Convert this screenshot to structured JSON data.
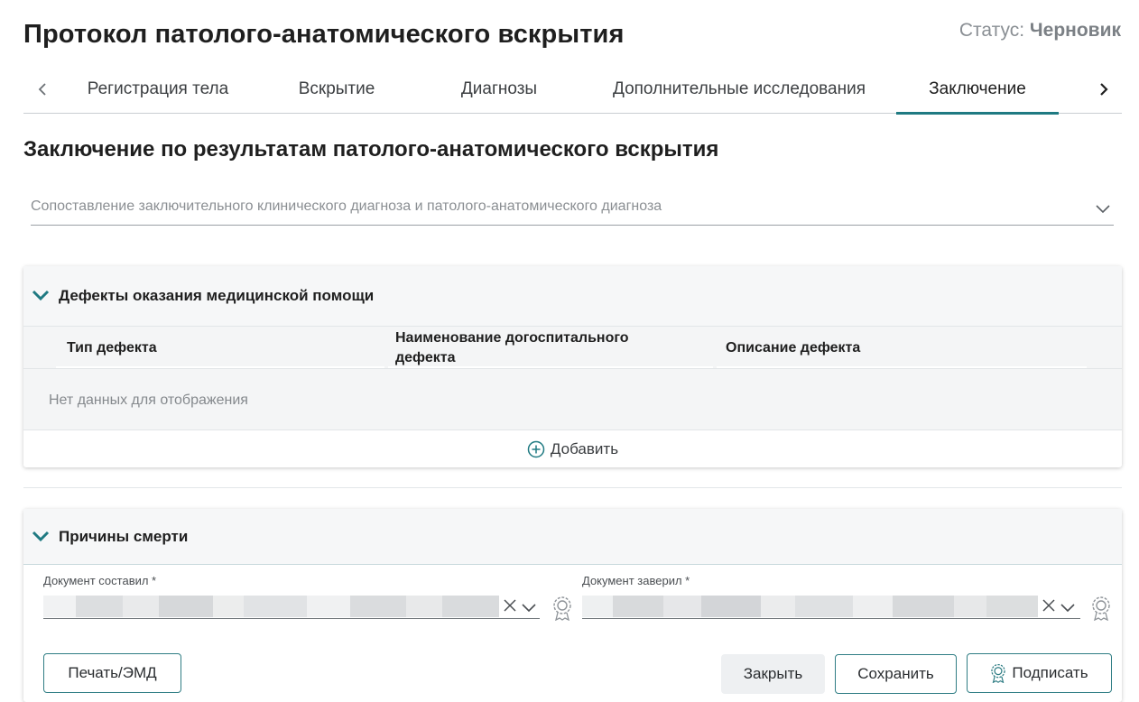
{
  "page": {
    "title": "Протокол патолого-анатомического вскрытия",
    "status_label": "Статус:",
    "status_value": "Черновик"
  },
  "tabs": [
    {
      "label": "Регистрация тела",
      "active": false
    },
    {
      "label": "Вскрытие",
      "active": false
    },
    {
      "label": "Диагнозы",
      "active": false
    },
    {
      "label": "Дополнительные исследования",
      "active": false
    },
    {
      "label": "Заключение",
      "active": true
    }
  ],
  "section": {
    "title": "Заключение по результатам патолого-анатомического вскрытия",
    "comparison_select_placeholder": "Сопоставление заключительного клинического диагноза и патолого-анатомического диагноза"
  },
  "defects": {
    "title": "Дефекты оказания медицинской помощи",
    "columns": [
      "Тип дефекта",
      "Наименование догоспитального дефекта",
      "Описание дефекта"
    ],
    "rows": [],
    "empty_text": "Нет данных для отображения",
    "add_label": "Добавить"
  },
  "death_causes": {
    "title": "Причины смерти",
    "composed_by_label": "Документ составил *",
    "certified_by_label": "Документ заверил *"
  },
  "actions": {
    "print_label": "Печать/ЭМД",
    "close_label": "Закрыть",
    "save_label": "Сохранить",
    "sign_label": "Подписать"
  },
  "colors": {
    "accent": "#1f7a82",
    "text": "#1f1f1f",
    "muted": "#8a8f94"
  }
}
